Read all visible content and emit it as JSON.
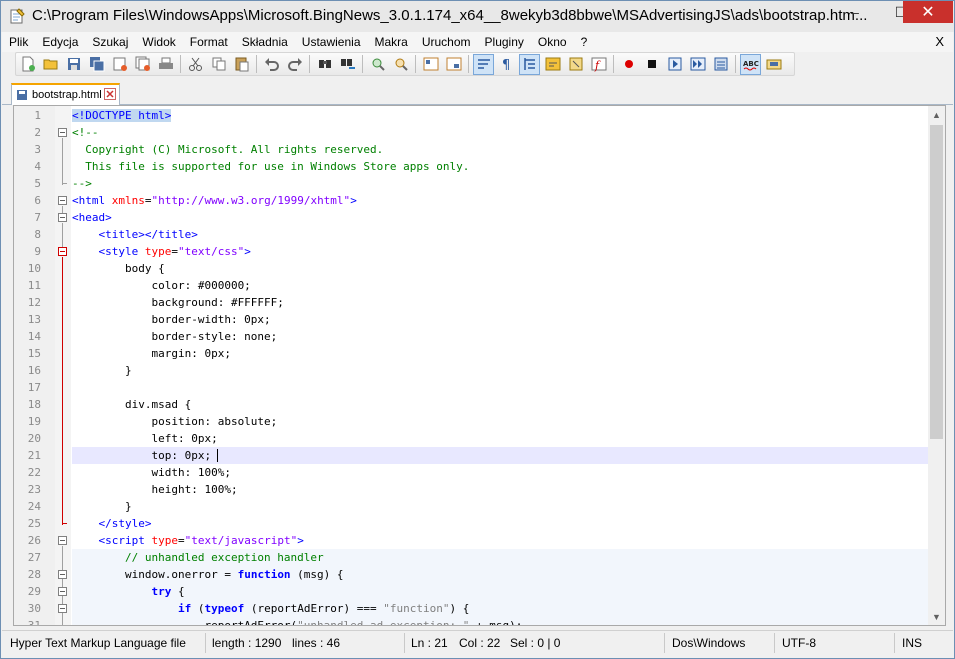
{
  "window": {
    "title": "C:\\Program Files\\WindowsApps\\Microsoft.BingNews_3.0.1.174_x64__8wekyb3d8bbwe\\MSAdvertisingJS\\ads\\bootstrap.htm...",
    "min_label": "–",
    "max_label": "☐",
    "close_label": "✕"
  },
  "menu": {
    "items": [
      "Plik",
      "Edycja",
      "Szukaj",
      "Widok",
      "Format",
      "Składnia",
      "Ustawienia",
      "Makra",
      "Uruchom",
      "Pluginy",
      "Okno",
      "?"
    ],
    "close": "X"
  },
  "toolbar": {
    "icons": [
      "new-file-icon",
      "open-file-icon",
      "save-icon",
      "save-all-icon",
      "close-icon",
      "close-all-icon",
      "print-icon",
      "cut-icon",
      "copy-icon",
      "paste-icon",
      "undo-icon",
      "redo-icon",
      "find-icon",
      "replace-icon",
      "zoom-in-icon",
      "zoom-out-icon",
      "sync-vertical-icon",
      "sync-horizontal-icon",
      "word-wrap-icon",
      "show-all-chars-icon",
      "indent-guide-icon",
      "user-lang-icon",
      "doc-map-icon",
      "function-list-icon",
      "record-macro-icon",
      "stop-macro-icon",
      "play-macro-icon",
      "run-macro-multiple-icon",
      "save-macro-icon",
      "spellcheck-icon",
      "spellcheck-settings-icon"
    ]
  },
  "tab": {
    "label": "bootstrap.html"
  },
  "editor": {
    "lines": [
      {
        "n": "1",
        "segs": [
          {
            "c": "doctype tag",
            "t": "<!DOCTYPE html>"
          }
        ]
      },
      {
        "n": "2",
        "segs": [
          {
            "c": "cmt",
            "t": "<!--"
          }
        ]
      },
      {
        "n": "3",
        "segs": [
          {
            "c": "cmt",
            "t": "  Copyright (C) Microsoft. All rights reserved."
          }
        ]
      },
      {
        "n": "4",
        "segs": [
          {
            "c": "cmt",
            "t": "  This file is supported for use in Windows Store apps only."
          }
        ]
      },
      {
        "n": "5",
        "segs": [
          {
            "c": "cmt",
            "t": "-->"
          }
        ]
      },
      {
        "n": "6",
        "segs": [
          {
            "c": "tag",
            "t": "<html "
          },
          {
            "c": "attr",
            "t": "xmlns"
          },
          {
            "c": "txt",
            "t": "="
          },
          {
            "c": "val",
            "t": "\"http://www.w3.org/1999/xhtml\""
          },
          {
            "c": "tag",
            "t": ">"
          }
        ]
      },
      {
        "n": "7",
        "segs": [
          {
            "c": "tag",
            "t": "<head>"
          }
        ]
      },
      {
        "n": "8",
        "segs": [
          {
            "c": "tag",
            "t": "    <title></title>"
          }
        ]
      },
      {
        "n": "9",
        "segs": [
          {
            "c": "tag",
            "t": "    <style "
          },
          {
            "c": "attr",
            "t": "type"
          },
          {
            "c": "txt",
            "t": "="
          },
          {
            "c": "val",
            "t": "\"text/css\""
          },
          {
            "c": "tag",
            "t": ">"
          }
        ]
      },
      {
        "n": "10",
        "segs": [
          {
            "c": "txt",
            "t": "        body {"
          }
        ]
      },
      {
        "n": "11",
        "segs": [
          {
            "c": "txt",
            "t": "            color: #000000;"
          }
        ]
      },
      {
        "n": "12",
        "segs": [
          {
            "c": "txt",
            "t": "            background: #FFFFFF;"
          }
        ]
      },
      {
        "n": "13",
        "segs": [
          {
            "c": "txt",
            "t": "            border-width: 0px;"
          }
        ]
      },
      {
        "n": "14",
        "segs": [
          {
            "c": "txt",
            "t": "            border-style: none;"
          }
        ]
      },
      {
        "n": "15",
        "segs": [
          {
            "c": "txt",
            "t": "            margin: 0px;"
          }
        ]
      },
      {
        "n": "16",
        "segs": [
          {
            "c": "txt",
            "t": "        }"
          }
        ]
      },
      {
        "n": "17",
        "segs": [
          {
            "c": "txt",
            "t": ""
          }
        ]
      },
      {
        "n": "18",
        "segs": [
          {
            "c": "txt",
            "t": "        div.msad {"
          }
        ]
      },
      {
        "n": "19",
        "segs": [
          {
            "c": "txt",
            "t": "            position: absolute;"
          }
        ]
      },
      {
        "n": "20",
        "segs": [
          {
            "c": "txt",
            "t": "            left: 0px;"
          }
        ]
      },
      {
        "n": "21",
        "segs": [
          {
            "c": "txt",
            "t": "            top: 0px;"
          }
        ]
      },
      {
        "n": "22",
        "segs": [
          {
            "c": "txt",
            "t": "            width: 100%;"
          }
        ]
      },
      {
        "n": "23",
        "segs": [
          {
            "c": "txt",
            "t": "            height: 100%;"
          }
        ]
      },
      {
        "n": "24",
        "segs": [
          {
            "c": "txt",
            "t": "        }"
          }
        ]
      },
      {
        "n": "25",
        "segs": [
          {
            "c": "tag",
            "t": "    </style>"
          }
        ]
      },
      {
        "n": "26",
        "segs": [
          {
            "c": "tag",
            "t": "    <script "
          },
          {
            "c": "attr",
            "t": "type"
          },
          {
            "c": "txt",
            "t": "="
          },
          {
            "c": "val",
            "t": "\"text/javascript\""
          },
          {
            "c": "tag",
            "t": ">"
          }
        ]
      },
      {
        "n": "27",
        "segs": [
          {
            "c": "cmt",
            "t": "        // unhandled exception handler"
          }
        ]
      },
      {
        "n": "28",
        "segs": [
          {
            "c": "txt",
            "t": "        window.onerror = "
          },
          {
            "c": "kw",
            "t": "function"
          },
          {
            "c": "txt",
            "t": " (msg) {"
          }
        ]
      },
      {
        "n": "29",
        "segs": [
          {
            "c": "kw",
            "t": "            try"
          },
          {
            "c": "txt",
            "t": " {"
          }
        ]
      },
      {
        "n": "30",
        "segs": [
          {
            "c": "kw",
            "t": "                if"
          },
          {
            "c": "txt",
            "t": " ("
          },
          {
            "c": "kw",
            "t": "typeof"
          },
          {
            "c": "txt",
            "t": " (reportAdError) === "
          },
          {
            "c": "str",
            "t": "\"function\""
          },
          {
            "c": "txt",
            "t": ") {"
          }
        ]
      },
      {
        "n": "31",
        "segs": [
          {
            "c": "txt",
            "t": "                    reportAdError("
          },
          {
            "c": "str",
            "t": "\"unhandled ad exception: \""
          },
          {
            "c": "txt",
            "t": " + msg);"
          }
        ]
      }
    ]
  },
  "status": {
    "filetype": "Hyper Text Markup Language file",
    "length": "length : 1290",
    "lines": "lines : 46",
    "ln": "Ln : 21",
    "col": "Col : 22",
    "sel": "Sel : 0 | 0",
    "eol": "Dos\\Windows",
    "encoding": "UTF-8",
    "mode": "INS"
  }
}
